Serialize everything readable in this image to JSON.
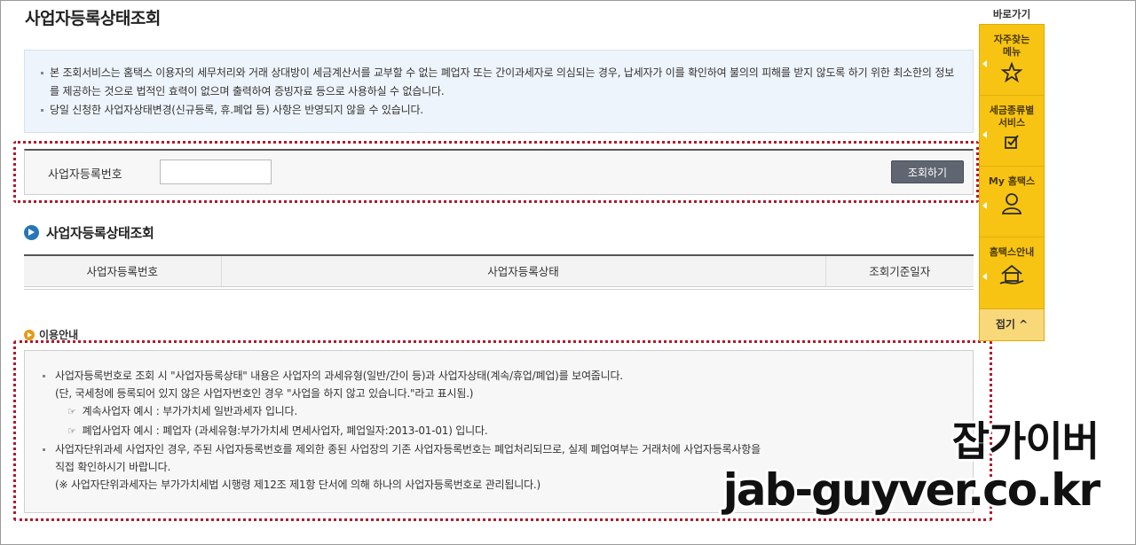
{
  "page": {
    "title": "사업자등록상태조회"
  },
  "notice": {
    "items": [
      "본 조회서비스는 홈택스 이용자의 세무처리와 거래 상대방이 세금계산서를 교부할 수 없는 폐업자 또는 간이과세자로 의심되는 경우, 납세자가 이를 확인하여 불의의 피해를 받지 않도록 하기 위한 최소한의 정보를 제공하는 것으로 법적인 효력이 없으며 출력하여 증빙자료 등으로 사용하실 수 없습니다.",
      "당일 신청한 사업자상태변경(신규등록, 휴.폐업 등) 사항은 반영되지 않을 수 있습니다."
    ]
  },
  "search": {
    "label": "사업자등록번호",
    "value": "",
    "placeholder": "",
    "button": "조회하기"
  },
  "result": {
    "title": "사업자등록상태조회",
    "columns": [
      "사업자등록번호",
      "사업자등록상태",
      "조회기준일자"
    ]
  },
  "guide": {
    "title": "이용안내",
    "line1": "사업자등록번호로 조회 시 \"사업자등록상태\" 내용은 사업자의 과세유형(일반/간이 등)과 사업자상태(계속/휴업/폐업)를 보여줍니다.",
    "line2": "(단, 국세청에 등록되어 있지 않은 사업자번호인 경우 \"사업을 하지 않고 있습니다.\"라고 표시됨.)",
    "ex1": "계속사업자 예시 : 부가가치세 일반과세자 입니다.",
    "ex2": "폐업사업자 예시 : 폐업자 (과세유형:부가가치세 면세사업자, 폐업일자:2013-01-01) 입니다.",
    "line3a": "사업자단위과세 사업자인 경우, 주된 사업자등록번호를 제외한 종된 사업장의 기존 사업자등록번호는 폐업처리되므로, 실제 폐업여부는 거래처에 사업자등록사항을",
    "line3b": "직접 확인하시기 바랍니다.",
    "line4": "(※ 사업자단위과세자는 부가가치세법 시행령 제12조 제1항 단서에 의해 하나의 사업자등록번호로 관리됩니다.)"
  },
  "quick": {
    "title": "바로가기",
    "items": [
      {
        "label_l1": "자주찾는",
        "label_l2": "메뉴",
        "icon": "star-icon"
      },
      {
        "label_l1": "세금종류별",
        "label_l2": "서비스",
        "icon": "checkbox-icon"
      },
      {
        "label_l1": "My 홈택스",
        "label_l2": "",
        "icon": "person-icon"
      },
      {
        "label_l1": "홈택스안내",
        "label_l2": "",
        "icon": "house-hand-icon"
      }
    ],
    "fold": "접기 ^"
  },
  "watermark": {
    "korean": "잡가이버",
    "url": "jab-guyver.co.kr"
  },
  "colors": {
    "accent_blue": "#2776b8",
    "quick_yellow": "#f7c414",
    "highlight_red": "#b5182a",
    "button_gray": "#606671"
  }
}
